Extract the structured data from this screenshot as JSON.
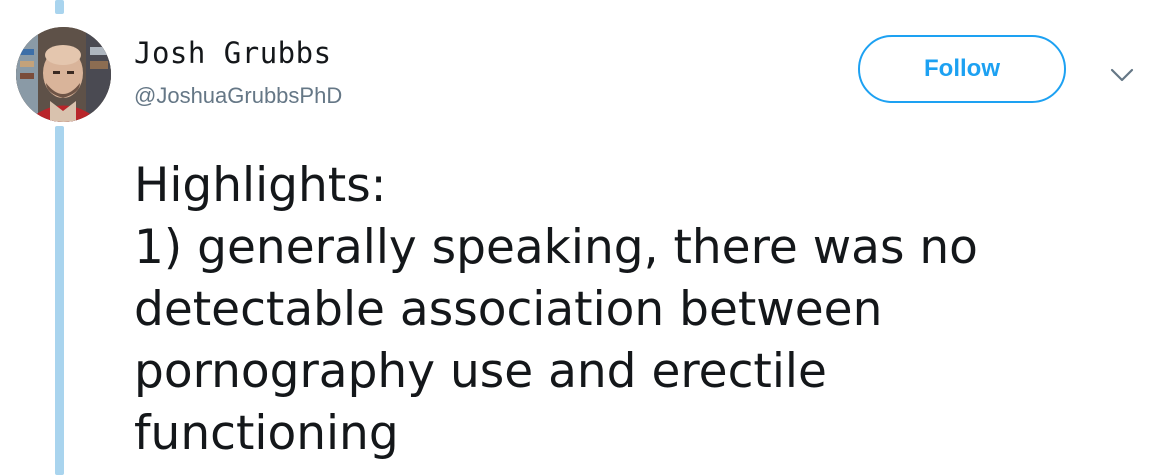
{
  "colors": {
    "accent": "#1da1f2",
    "thread_line": "#a9d4ee",
    "text_primary": "#14171a",
    "text_secondary": "#657786"
  },
  "author": {
    "display_name": "Josh Grubbs",
    "handle": "@JoshuaGrubbsPhD",
    "avatar_icon": "profile-photo"
  },
  "actions": {
    "follow_label": "Follow",
    "menu_icon": "chevron-down-icon"
  },
  "tweet": {
    "lines": [
      "Highlights:",
      "1) generally speaking, there was no",
      "detectable association between",
      "pornography use and erectile",
      "functioning"
    ]
  }
}
